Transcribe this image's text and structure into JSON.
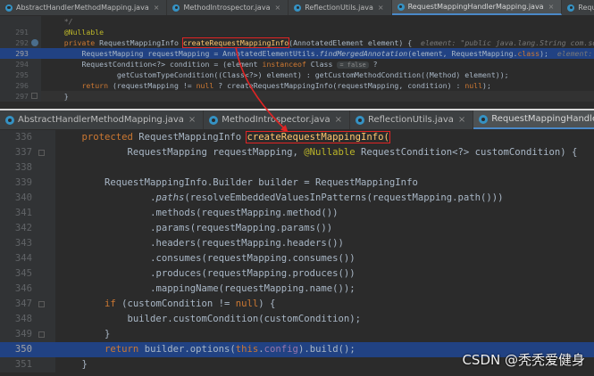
{
  "top_tabs": [
    {
      "label": "AbstractHandlerMethodMapping.java",
      "active": false
    },
    {
      "label": "MethodIntrospector.java",
      "active": false
    },
    {
      "label": "ReflectionUtils.java",
      "active": false
    },
    {
      "label": "RequestMappingHandlerMapping.java",
      "active": true
    },
    {
      "label": "RequestMappingInfo.java",
      "active": false
    }
  ],
  "top_code": {
    "line_0": {
      "num": "",
      "text": "*/"
    },
    "line_291": {
      "num": "291",
      "ann": "@Nullable"
    },
    "line_292": {
      "num": "292",
      "kw": "private",
      "type": " RequestMappingInfo ",
      "method": "createRequestMappingInfo",
      "rest": "(AnnotatedElement element) {",
      "hint": "element: \"public java.lang.String com.soin"
    },
    "line_293": {
      "num": "293",
      "p1": "RequestMapping requestMapping = AnnotatedElementUtils.",
      "p2": "findMergedAnnotation",
      "p3": "(element, RequestMapping.",
      "p4": "class",
      "p5": ");",
      "hint": "element: \"p"
    },
    "line_294": {
      "num": "294",
      "p1": "RequestCondition<?> condition = (element ",
      "p2": "instanceof",
      "p3": " Class",
      "pill": "= false",
      "p4": " ?"
    },
    "line_295": {
      "num": "295",
      "text": "getCustomTypeCondition((Class<?>) element) : getCustomMethodCondition((Method) element));"
    },
    "line_296": {
      "num": "296",
      "kw": "return",
      "p1": " (requestMapping != ",
      "null": "null",
      "p2": " ? createRequestMappingInfo(requestMapping, condition) : ",
      "null2": "null",
      "p3": ");"
    },
    "line_297": {
      "num": "297",
      "text": "}"
    }
  },
  "bottom_tabs": [
    {
      "label": "AbstractHandlerMethodMapping.java",
      "active": false
    },
    {
      "label": "MethodIntrospector.java",
      "active": false
    },
    {
      "label": "ReflectionUtils.java",
      "active": false
    },
    {
      "label": "RequestMappingHandlerMapping.java",
      "active": true
    },
    {
      "label": "R",
      "active": false
    }
  ],
  "bottom_code": {
    "line_336": {
      "num": "336",
      "kw": "protected",
      "type": " RequestMappingInfo ",
      "method": "createRequestMappingInfo("
    },
    "line_337": {
      "num": "337",
      "p1": "RequestMapping requestMapping, ",
      "ann": "@Nullable",
      "p2": " RequestCondition<?> customCondition) {"
    },
    "line_338": {
      "num": "338",
      "text": ""
    },
    "line_339": {
      "num": "339",
      "text": "RequestMappingInfo.Builder builder = RequestMappingInfo"
    },
    "line_340": {
      "num": "340",
      "dot": ".",
      "ital": "paths",
      "rest": "(resolveEmbeddedValuesInPatterns(requestMapping.path()))"
    },
    "line_341": {
      "num": "341",
      "text": ".methods(requestMapping.method())"
    },
    "line_342": {
      "num": "342",
      "text": ".params(requestMapping.params())"
    },
    "line_343": {
      "num": "343",
      "text": ".headers(requestMapping.headers())"
    },
    "line_344": {
      "num": "344",
      "text": ".consumes(requestMapping.consumes())"
    },
    "line_345": {
      "num": "345",
      "text": ".produces(requestMapping.produces())"
    },
    "line_346": {
      "num": "346",
      "text": ".mappingName(requestMapping.name());"
    },
    "line_347": {
      "num": "347",
      "kw": "if",
      "p1": " (customCondition != ",
      "null": "null",
      "p2": ") {"
    },
    "line_348": {
      "num": "348",
      "text": "builder.customCondition(customCondition);"
    },
    "line_349": {
      "num": "349",
      "text": "}"
    },
    "line_350": {
      "num": "350",
      "kw": "return",
      "p1": " builder.options(",
      "this": "this",
      "p2": ".",
      "fld": "config",
      "p3": ").build();"
    },
    "line_351": {
      "num": "351",
      "text": "}"
    }
  },
  "watermark": "CSDN @秃秃爱健身",
  "colors": {
    "selection": "#214283",
    "keyword": "#cc7832",
    "annotation": "#bbb529",
    "highlight_box": "#e02424"
  }
}
